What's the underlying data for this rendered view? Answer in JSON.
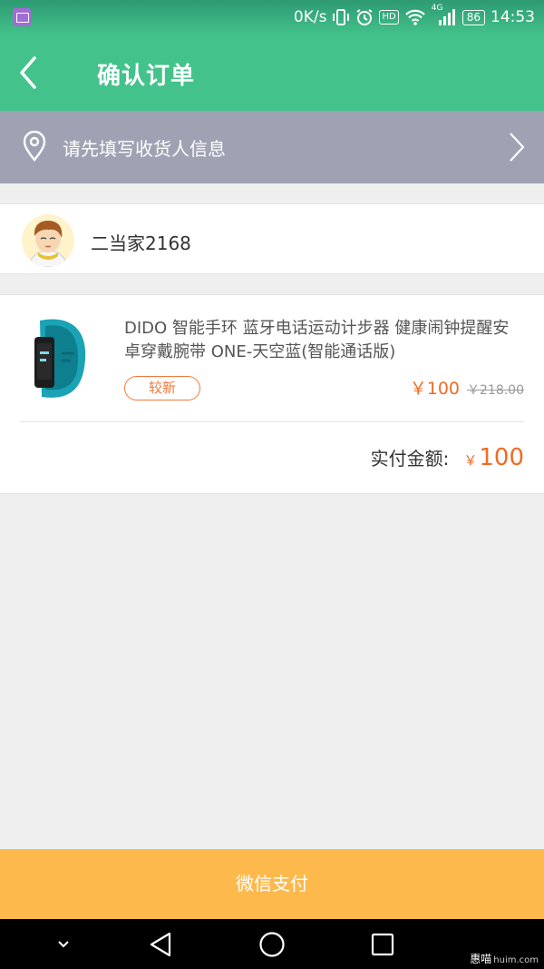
{
  "status_bar": {
    "net_speed": "0K/s",
    "hd": "HD",
    "network": "4G",
    "battery": "86",
    "time": "14:53"
  },
  "header": {
    "title": "确认订单"
  },
  "address": {
    "prompt": "请先填写收货人信息"
  },
  "seller": {
    "name": "二当家2168"
  },
  "product": {
    "title": "DIDO 智能手环 蓝牙电话运动计步器 健康闹钟提醒安卓穿戴腕带 ONE-天空蓝(智能通话版)",
    "condition": "较新",
    "price": "￥100",
    "original_price": "￥218.00"
  },
  "total": {
    "label": "实付金额:",
    "currency": "￥",
    "amount": "100"
  },
  "pay_button": {
    "label": "微信支付"
  },
  "watermark": {
    "brand": "惠喵",
    "url": "huim.com"
  },
  "colors": {
    "primary_green": "#43c38b",
    "address_bar": "#9ea2b3",
    "price_orange": "#f06b23",
    "pay_button": "#fdb94c"
  }
}
